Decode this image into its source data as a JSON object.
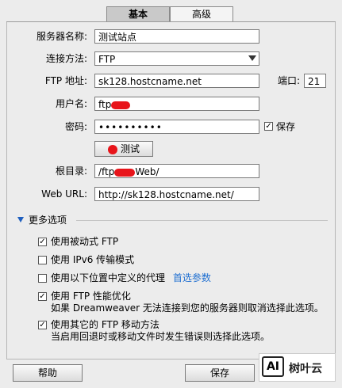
{
  "tabs": [
    {
      "label": "基本"
    },
    {
      "label": "高级"
    }
  ],
  "form": {
    "server_name": {
      "label": "服务器名称:",
      "value": "测试站点"
    },
    "connect_method": {
      "label": "连接方法:",
      "value": "FTP"
    },
    "ftp_address": {
      "label": "FTP 地址:",
      "value": "sk128.hostcname.net"
    },
    "port": {
      "label": "端口:",
      "value": "21"
    },
    "username": {
      "label": "用户名:",
      "value": "ftp"
    },
    "password": {
      "label": "密码:",
      "value": "••••••••••",
      "save_label": "保存"
    },
    "test_button": {
      "label": "测试"
    },
    "root_dir": {
      "label": "根目录:",
      "value_prefix": "/ftp",
      "value_suffix": "Web/"
    },
    "web_url": {
      "label": "Web URL:",
      "value": "http://sk128.hostcname.net/"
    }
  },
  "more_options": {
    "title": "更多选项",
    "items": [
      {
        "label": "使用被动式 FTP",
        "checked": true
      },
      {
        "label": "使用 IPv6 传输模式",
        "checked": false
      },
      {
        "label": "使用以下位置中定义的代理",
        "link": "首选参数",
        "checked": false
      },
      {
        "label": "使用 FTP 性能优化",
        "desc": "如果 Dreamweaver 无法连接到您的服务器则取消选择此选项。",
        "checked": true
      },
      {
        "label": "使用其它的 FTP 移动方法",
        "desc": "当启用回退时或移动文件时发生错误则选择此选项。",
        "checked": true
      }
    ]
  },
  "footer": {
    "help_label": "帮助",
    "save_label": "保存"
  },
  "watermark": {
    "logo": "AI",
    "text": "树叶云"
  },
  "colors": {
    "redaction": "#e8141a",
    "link": "#1f6fd1"
  }
}
